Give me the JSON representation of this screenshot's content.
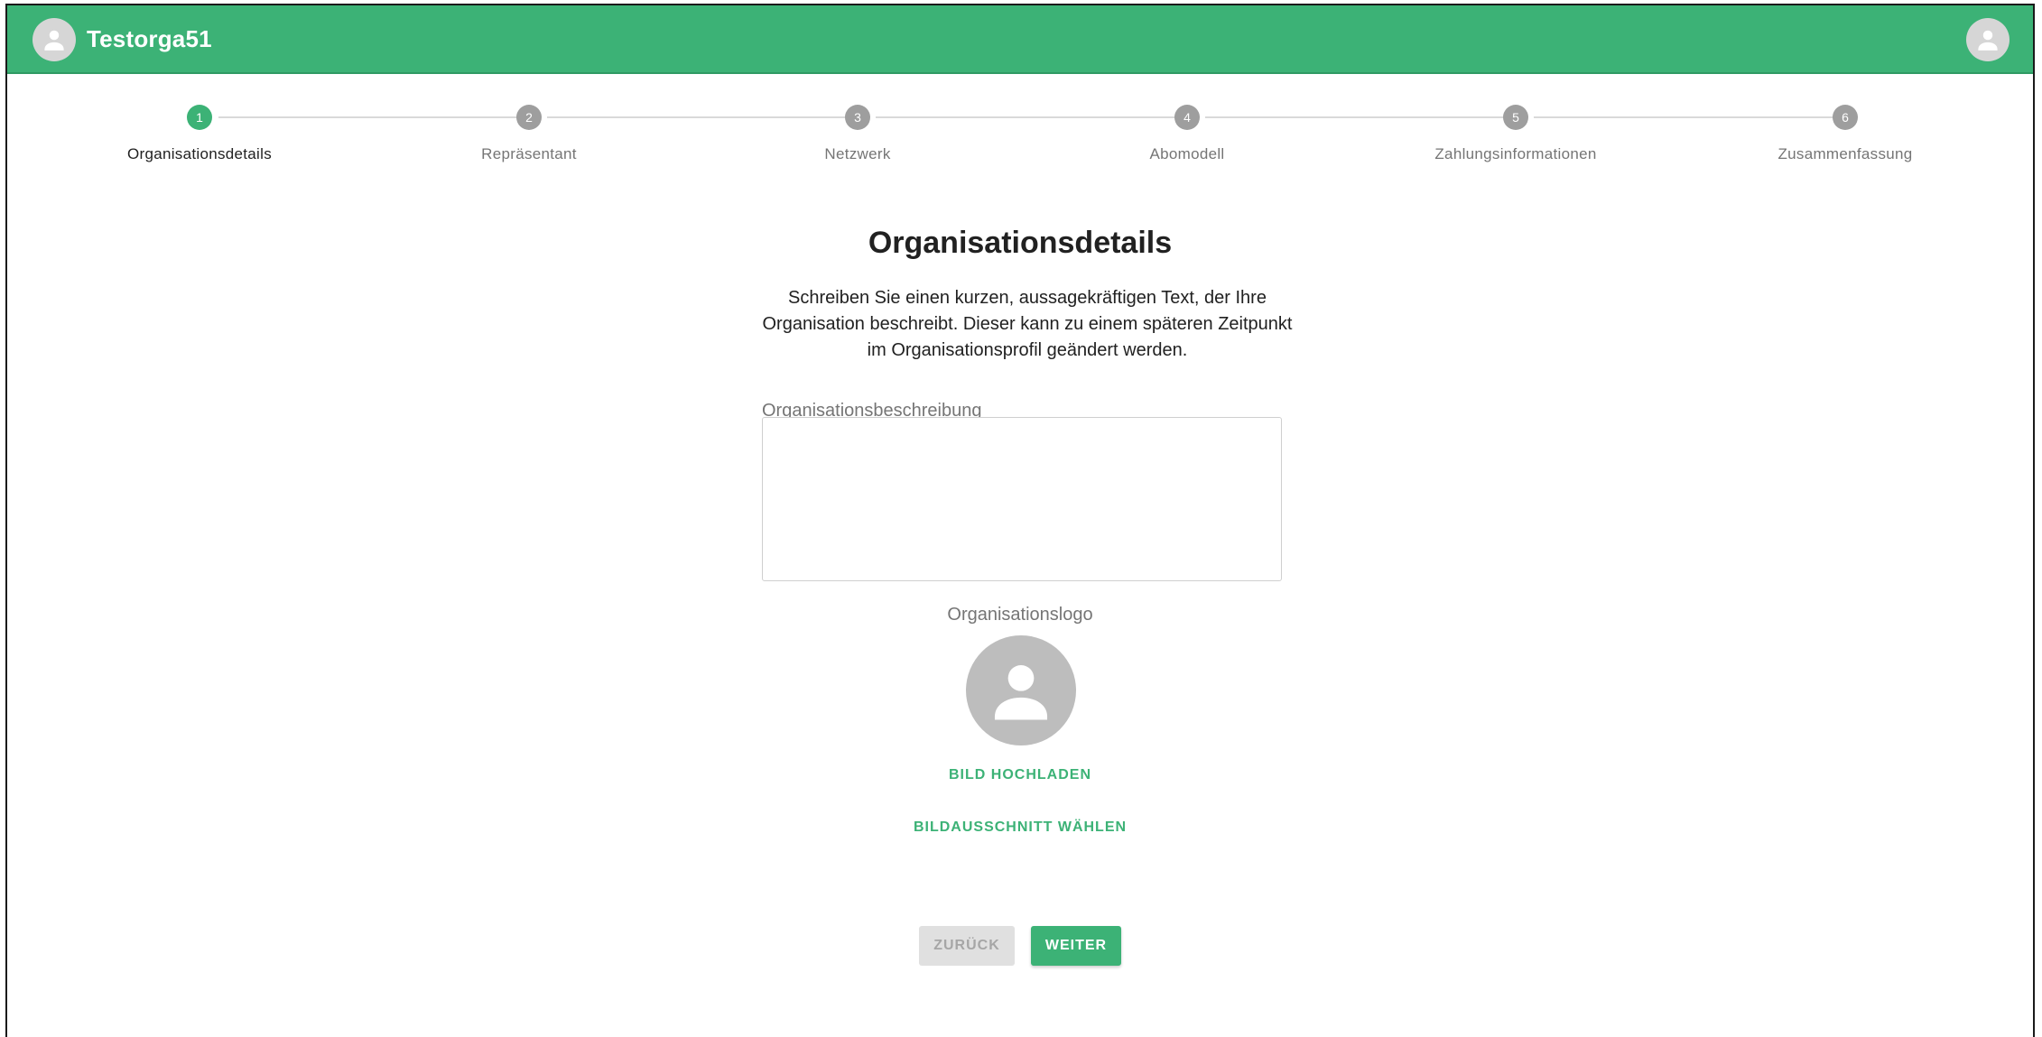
{
  "appbar": {
    "org_name": "Testorga51",
    "org_avatar_icon": "person-icon",
    "user_avatar_icon": "person-icon",
    "color": "#3cb276"
  },
  "stepper": {
    "steps": [
      {
        "number": "1",
        "label": "Organisationsdetails",
        "active": true
      },
      {
        "number": "2",
        "label": "Repräsentant",
        "active": false
      },
      {
        "number": "3",
        "label": "Netzwerk",
        "active": false
      },
      {
        "number": "4",
        "label": "Abomodell",
        "active": false
      },
      {
        "number": "5",
        "label": "Zahlungsinformationen",
        "active": false
      },
      {
        "number": "6",
        "label": "Zusammenfassung",
        "active": false
      }
    ]
  },
  "main": {
    "title": "Organisationsdetails",
    "intro": "Schreiben Sie einen kurzen, aussagekräftigen Text, der Ihre Organisation beschreibt. Dieser kann zu einem späteren Zeitpunkt im Organisationsprofil geändert werden.",
    "description_label": "Organisationsbeschreibung",
    "description_value": "",
    "logo_label": "Organisationslogo",
    "upload_label": "BILD HOCHLADEN",
    "crop_label": "BILDAUSSCHNITT WÄHLEN"
  },
  "footer": {
    "back_label": "ZURÜCK",
    "next_label": "WEITER"
  }
}
